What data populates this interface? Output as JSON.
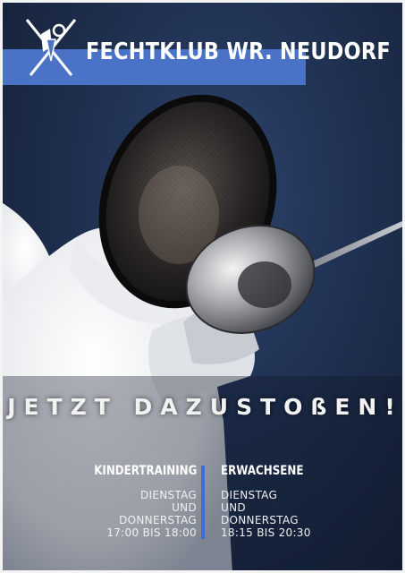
{
  "club": {
    "name": "FECHTKLUB WR. NEUDORF"
  },
  "tagline": "JETZT DAZUSTOßEN!",
  "schedule": {
    "kids": {
      "title": "KINDERTRAINING",
      "lines": [
        "DIENSTAG",
        "UND",
        "DONNERSTAG",
        "17:00 BIS 18:00"
      ]
    },
    "adults": {
      "title": "ERWACHSENE",
      "lines": [
        "DIENSTAG",
        "UND",
        "DONNERSTAG",
        "18:15 BIS 20:30"
      ]
    }
  },
  "colors": {
    "accent": "#4a73c8",
    "divider": "#3c6fd1",
    "background": "#1f3050"
  },
  "icons": {
    "logo": "crossed-swords-fencer-logo-icon"
  }
}
